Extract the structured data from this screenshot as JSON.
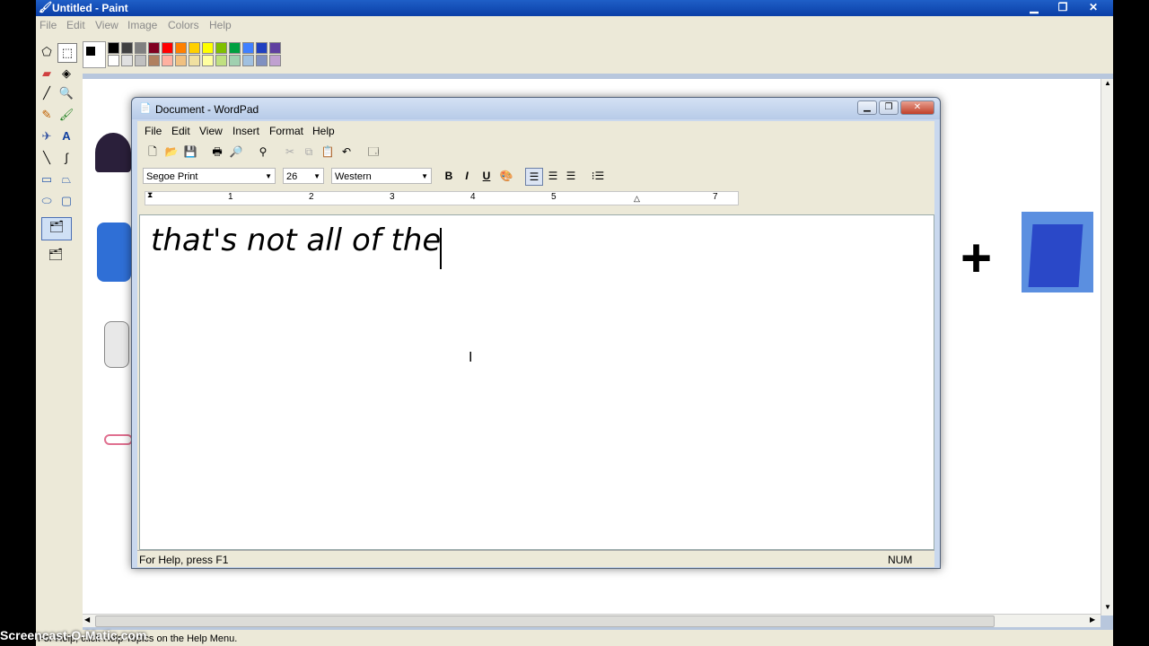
{
  "paint": {
    "title": "Untitled - Paint",
    "menu": [
      "File",
      "Edit",
      "View",
      "Image",
      "Colors",
      "Help"
    ],
    "status": "For Help, click Help Topics on the Help Menu.",
    "palette_top": [
      "#000000",
      "#404040",
      "#808080",
      "#800020",
      "#ff0000",
      "#ff8000",
      "#ffd000",
      "#ffff00",
      "#80c000",
      "#00a040",
      "#4080ff",
      "#2040c0",
      "#6040a0"
    ],
    "palette_bottom": [
      "#ffffff",
      "#e0e0e0",
      "#c0c0c0",
      "#b08060",
      "#ffb0a0",
      "#f0c080",
      "#f0e0a0",
      "#ffffa0",
      "#c0e080",
      "#a0d0b0",
      "#a0c0e0",
      "#8090c0",
      "#c0a0d0"
    ]
  },
  "wordpad": {
    "title": "Document - WordPad",
    "menu": [
      "File",
      "Edit",
      "View",
      "Insert",
      "Format",
      "Help"
    ],
    "font": "Segoe Print",
    "size": "26",
    "script": "Western",
    "ruler_marks": [
      "1",
      "2",
      "3",
      "4",
      "5",
      "7"
    ],
    "document_text": "that's not all of the",
    "status_left": "For Help, press F1",
    "status_right": "NUM"
  },
  "watermark": "Screencast-O-Matic.com",
  "canvas_art": {
    "plus": "+"
  }
}
